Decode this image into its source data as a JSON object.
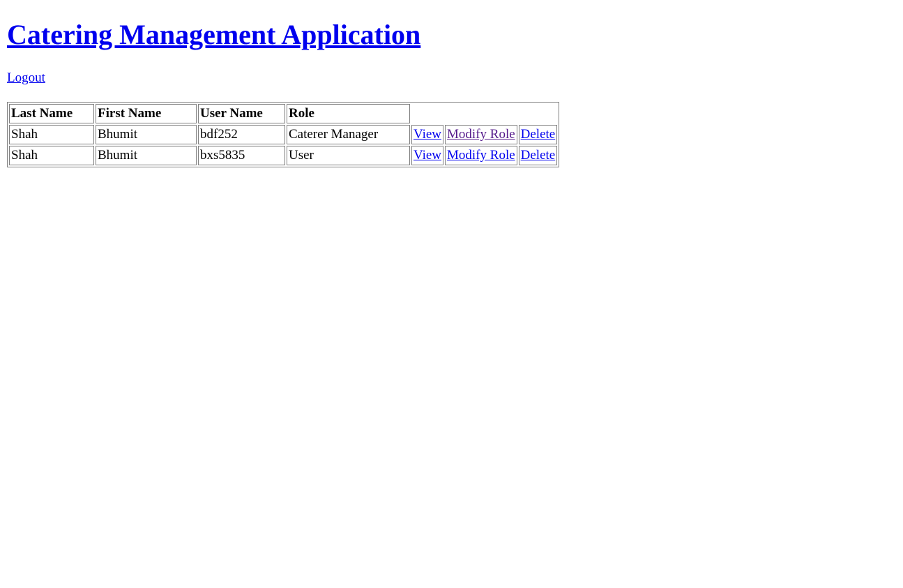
{
  "header": {
    "title": "Catering Management Application",
    "logout_label": "Logout"
  },
  "table": {
    "columns": [
      "Last Name",
      "First Name",
      "User Name",
      "Role"
    ],
    "rows": [
      {
        "last_name": "Shah",
        "first_name": "Bhumit",
        "user_name": "bdf252",
        "role": "Caterer Manager",
        "view_label": "View",
        "modify_label": "Modify Role",
        "delete_label": "Delete"
      },
      {
        "last_name": "Shah",
        "first_name": "Bhumit",
        "user_name": "bxs5835",
        "role": "User",
        "view_label": "View",
        "modify_label": "Modify Role",
        "delete_label": "Delete"
      }
    ]
  },
  "colors": {
    "link": "#0000ee",
    "visited_link": "#551a8b",
    "border": "#808080"
  }
}
